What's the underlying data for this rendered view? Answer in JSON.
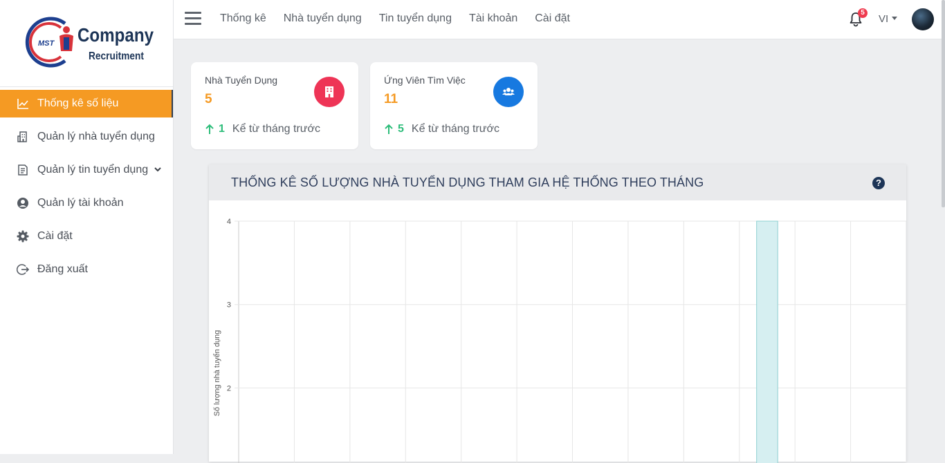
{
  "brand": {
    "logo_badge": "MST",
    "name": "Company",
    "tagline": "Recruitment"
  },
  "sidebar": {
    "items": [
      {
        "label": "Thống kê số liệu",
        "icon": "chart-line-icon",
        "active": true
      },
      {
        "label": "Quản lý nhà tuyển dụng",
        "icon": "building-icon"
      },
      {
        "label": "Quản lý tin tuyển dụng",
        "icon": "document-list-icon",
        "has_submenu": true
      },
      {
        "label": "Quản lý tài khoản",
        "icon": "user-circle-icon"
      },
      {
        "label": "Cài đặt",
        "icon": "gear-icon"
      },
      {
        "label": "Đăng xuất",
        "icon": "logout-icon"
      }
    ]
  },
  "topbar": {
    "nav": [
      "Thống kê",
      "Nhà tuyển dụng",
      "Tin tuyển dụng",
      "Tài khoản",
      "Cài đặt"
    ],
    "notification_count": "5",
    "language": "VI"
  },
  "stats": [
    {
      "title": "Nhà Tuyển Dụng",
      "value": "5",
      "change": "1",
      "change_text": "Kể từ tháng trước",
      "icon": "building-icon",
      "color": "#ee3456"
    },
    {
      "title": "Ứng Viên Tìm Việc",
      "value": "11",
      "change": "5",
      "change_text": "Kể từ tháng trước",
      "icon": "users-icon",
      "color": "#1779e0"
    }
  ],
  "colors": {
    "accent": "#f59a23",
    "positive": "#2dbd7a",
    "bar_fill": "#d6eff1",
    "bar_stroke": "#8fd0d2"
  },
  "panel": {
    "title": "THỐNG KÊ SỐ LƯỢNG NHÀ TUYỂN DỤNG THAM GIA HỆ THỐNG THEO THÁNG",
    "help": "?"
  },
  "chart_data": {
    "type": "bar",
    "ylabel": "Số lượng nhà tuyển dụng",
    "xlabel": "",
    "categories_count": 12,
    "values": [
      0,
      0,
      0,
      0,
      0,
      0,
      0,
      0,
      0,
      4,
      0,
      0
    ],
    "yticks": [
      2,
      3,
      4
    ],
    "ylim_visible": [
      1.1,
      4
    ],
    "grid": true
  }
}
